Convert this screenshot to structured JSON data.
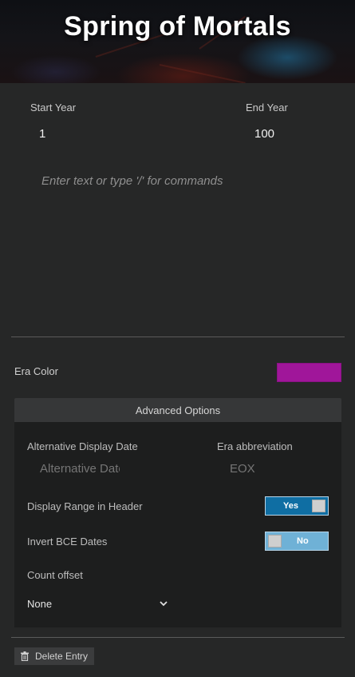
{
  "header": {
    "title": "Spring of Mortals"
  },
  "years": {
    "start_label": "Start Year",
    "start_value": "1",
    "end_label": "End Year",
    "end_value": "100"
  },
  "editor": {
    "placeholder": "Enter text or type '/' for commands"
  },
  "era_color": {
    "label": "Era Color",
    "value": "#a0169a"
  },
  "advanced": {
    "title": "Advanced Options",
    "alt_date_label": "Alternative Display Date",
    "alt_date_placeholder": "Alternative Date",
    "abbr_label": "Era abbreviation",
    "abbr_placeholder": "EOX",
    "display_range": {
      "label": "Display Range in Header",
      "state": "Yes"
    },
    "invert_bce": {
      "label": "Invert BCE Dates",
      "state": "No"
    },
    "count_offset": {
      "label": "Count offset",
      "selected": "None"
    }
  },
  "actions": {
    "delete_label": "Delete Entry"
  },
  "icons": {
    "chevron": "chevron-down-icon",
    "trash": "trash-icon"
  },
  "colors": {
    "toggle_on": "#0f6ea3",
    "toggle_off": "#6fb1d6",
    "background": "#262727"
  }
}
